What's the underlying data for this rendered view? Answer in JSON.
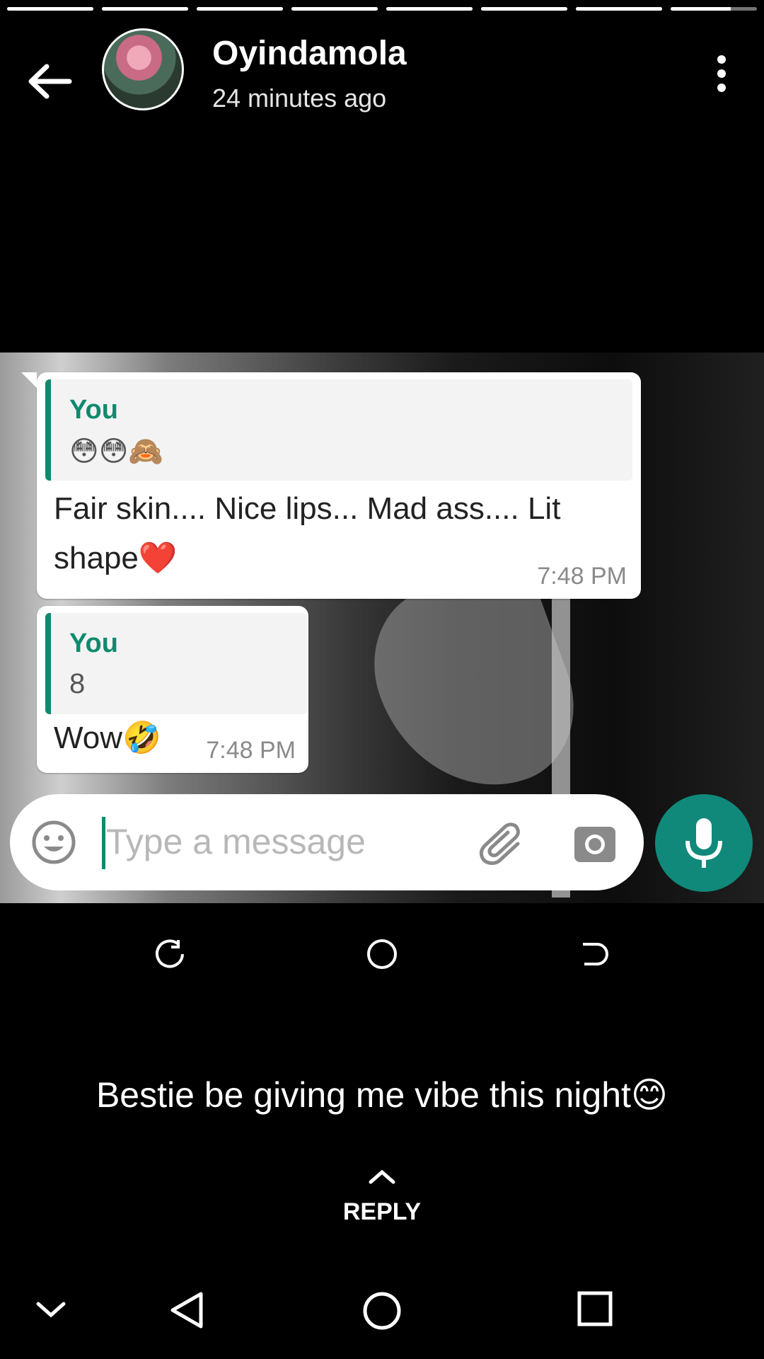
{
  "story": {
    "segments_total": 8,
    "segments_viewed": 8
  },
  "header": {
    "name": "Oyindamola",
    "time": "24 minutes ago",
    "back_icon": "arrow-left-icon",
    "menu_icon": "more-vert-icon"
  },
  "chat": {
    "messages": [
      {
        "quote_author": "You",
        "quote_text": "😳😳🙈",
        "text": "Fair skin.... Nice lips... Mad ass.... Lit shape❤️",
        "time": "7:48 PM"
      },
      {
        "quote_author": "You",
        "quote_text": "8",
        "text": "Wow🤣",
        "time": "7:48 PM"
      }
    ],
    "input_placeholder": "Type a message",
    "colors": {
      "accent": "#0f8a6e",
      "mic": "#10897a"
    }
  },
  "caption": "Bestie be giving me vibe this night😊",
  "reply": {
    "label": "REPLY",
    "icon": "chevron-up-icon"
  }
}
